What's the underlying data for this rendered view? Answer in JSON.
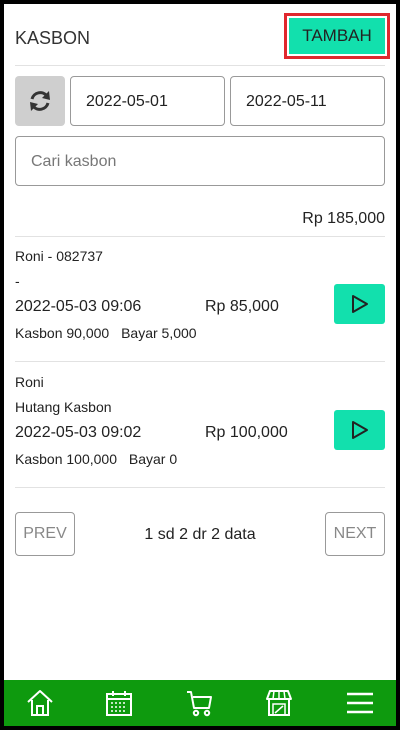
{
  "header": {
    "title": "KASBON",
    "add_label": "TAMBAH"
  },
  "filter": {
    "refresh_icon": "refresh-icon",
    "date_from": "2022-05-01",
    "date_to": "2022-05-11",
    "search_placeholder": "Cari kasbon"
  },
  "summary": {
    "total": "Rp 185,000"
  },
  "entries": [
    {
      "name": "Roni - 082737",
      "note": "-",
      "datetime": "2022-05-03 09:06",
      "amount": "Rp 85,000",
      "kasbon": "Kasbon 90,000",
      "bayar": "Bayar 5,000"
    },
    {
      "name": "Roni",
      "note": "Hutang Kasbon",
      "datetime": "2022-05-03 09:02",
      "amount": "Rp 100,000",
      "kasbon": "Kasbon 100,000",
      "bayar": "Bayar 0"
    }
  ],
  "pagination": {
    "prev": "PREV",
    "info": "1 sd 2 dr 2 data",
    "next": "NEXT"
  },
  "nav": {
    "items": [
      "home-icon",
      "calendar-icon",
      "cart-icon",
      "store-icon",
      "menu-icon"
    ]
  },
  "colors": {
    "accent": "#12e0ad",
    "nav_bg": "#0e9a0e",
    "highlight_border": "#e0282e"
  }
}
